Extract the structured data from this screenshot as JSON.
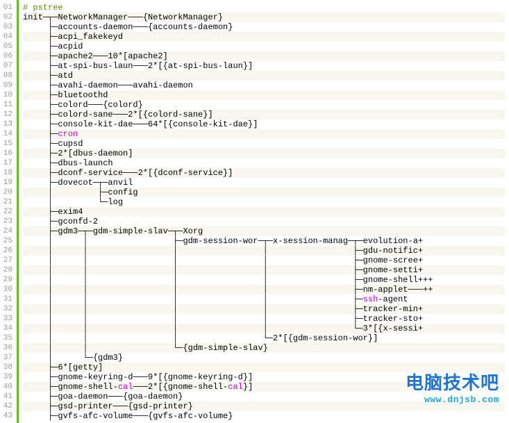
{
  "watermark": {
    "cn": "电脑技术吧",
    "url": "www.dnjsb.com"
  },
  "lines": [
    {
      "n": "01",
      "spans": [
        {
          "t": "# pstree",
          "c": "comment"
        }
      ]
    },
    {
      "n": "02",
      "spans": [
        {
          "t": "init─┬─NetworkManager───{NetworkManager}"
        }
      ]
    },
    {
      "n": "03",
      "spans": [
        {
          "t": "     ├─accounts-daemon───{accounts-daemon}"
        }
      ]
    },
    {
      "n": "04",
      "spans": [
        {
          "t": "     ├─acpi_fakekeyd"
        }
      ]
    },
    {
      "n": "05",
      "spans": [
        {
          "t": "     ├─acpid"
        }
      ]
    },
    {
      "n": "06",
      "spans": [
        {
          "t": "     ├─apache2───10*[apache2]"
        }
      ]
    },
    {
      "n": "07",
      "spans": [
        {
          "t": "     ├─at-spi-bus-laun───2*[{at-spi-bus-laun}]"
        }
      ]
    },
    {
      "n": "08",
      "spans": [
        {
          "t": "     ├─atd"
        }
      ]
    },
    {
      "n": "09",
      "spans": [
        {
          "t": "     ├─avahi-daemon───avahi-daemon"
        }
      ]
    },
    {
      "n": "10",
      "spans": [
        {
          "t": "     ├─bluetoothd"
        }
      ]
    },
    {
      "n": "11",
      "spans": [
        {
          "t": "     ├─colord───{colord}"
        }
      ]
    },
    {
      "n": "12",
      "spans": [
        {
          "t": "     ├─colord-sane───2*[{colord-sane}]"
        }
      ]
    },
    {
      "n": "13",
      "spans": [
        {
          "t": "     ├─console-kit-dae───64*[{console-kit-dae}]"
        }
      ]
    },
    {
      "n": "14",
      "spans": [
        {
          "t": "     ├─"
        },
        {
          "t": "cron",
          "c": "hl"
        }
      ]
    },
    {
      "n": "15",
      "spans": [
        {
          "t": "     ├─cupsd"
        }
      ]
    },
    {
      "n": "16",
      "spans": [
        {
          "t": "     ├─2*[dbus-daemon]"
        }
      ]
    },
    {
      "n": "17",
      "spans": [
        {
          "t": "     ├─dbus-launch"
        }
      ]
    },
    {
      "n": "18",
      "spans": [
        {
          "t": "     ├─dconf-service───2*[{dconf-service}]"
        }
      ]
    },
    {
      "n": "19",
      "spans": [
        {
          "t": "     ├─dovecot─┬─anvil"
        }
      ]
    },
    {
      "n": "20",
      "spans": [
        {
          "t": "     │         ├─config"
        }
      ]
    },
    {
      "n": "21",
      "spans": [
        {
          "t": "     │         └─log"
        }
      ]
    },
    {
      "n": "22",
      "spans": [
        {
          "t": "     ├─exim4"
        }
      ]
    },
    {
      "n": "23",
      "spans": [
        {
          "t": "     ├─gconfd-2"
        }
      ]
    },
    {
      "n": "24",
      "spans": [
        {
          "t": "     ├─gdm3─┬─gdm-simple-slav─┬─Xorg"
        }
      ]
    },
    {
      "n": "25",
      "spans": [
        {
          "t": "     │      │                 ├─gdm-session-wor─┬─x-session-manag─┬─evolution-a+"
        }
      ]
    },
    {
      "n": "26",
      "spans": [
        {
          "t": "     │      │                 │                 │                 ├─gdu-notific+"
        }
      ]
    },
    {
      "n": "27",
      "spans": [
        {
          "t": "     │      │                 │                 │                 ├─gnome-scree+"
        }
      ]
    },
    {
      "n": "28",
      "spans": [
        {
          "t": "     │      │                 │                 │                 ├─gnome-setti+"
        }
      ]
    },
    {
      "n": "29",
      "spans": [
        {
          "t": "     │      │                 │                 │                 ├─gnome-shell+++"
        }
      ]
    },
    {
      "n": "30",
      "spans": [
        {
          "t": "     │      │                 │                 │                 ├─nm-applet───++"
        }
      ]
    },
    {
      "n": "31",
      "spans": [
        {
          "t": "     │      │                 │                 │                 ├─"
        },
        {
          "t": "ssh",
          "c": "hl"
        },
        {
          "t": "-agent"
        }
      ]
    },
    {
      "n": "32",
      "spans": [
        {
          "t": "     │      │                 │                 │                 ├─tracker-min+"
        }
      ]
    },
    {
      "n": "33",
      "spans": [
        {
          "t": "     │      │                 │                 │                 ├─tracker-sto+"
        }
      ]
    },
    {
      "n": "34",
      "spans": [
        {
          "t": "     │      │                 │                 │                 └─3*[{x-sessi+"
        }
      ]
    },
    {
      "n": "35",
      "spans": [
        {
          "t": "     │      │                 │                 └─2*[{gdm-session-wor}]"
        }
      ]
    },
    {
      "n": "36",
      "spans": [
        {
          "t": "     │      │                 └─{gdm-simple-slav}"
        }
      ]
    },
    {
      "n": "37",
      "spans": [
        {
          "t": "     │      └─{gdm3}"
        }
      ]
    },
    {
      "n": "38",
      "spans": [
        {
          "t": "     ├─6*[getty]"
        }
      ]
    },
    {
      "n": "39",
      "spans": [
        {
          "t": "     ├─gnome-keyring-d───9*[{gnome-keyring-d}]"
        }
      ]
    },
    {
      "n": "40",
      "spans": [
        {
          "t": "     ├─gnome-shell-"
        },
        {
          "t": "cal",
          "c": "hl"
        },
        {
          "t": "───2*[{gnome-shell-"
        },
        {
          "t": "cal",
          "c": "hl"
        },
        {
          "t": "}]"
        }
      ]
    },
    {
      "n": "41",
      "spans": [
        {
          "t": "     ├─goa-daemon───{goa-daemon}"
        }
      ]
    },
    {
      "n": "42",
      "spans": [
        {
          "t": "     ├─gsd-printer───{gsd-printer}"
        }
      ]
    },
    {
      "n": "43",
      "spans": [
        {
          "t": "     ├─gvfs-afc-volume───{gvfs-afc-volume}"
        }
      ]
    }
  ]
}
